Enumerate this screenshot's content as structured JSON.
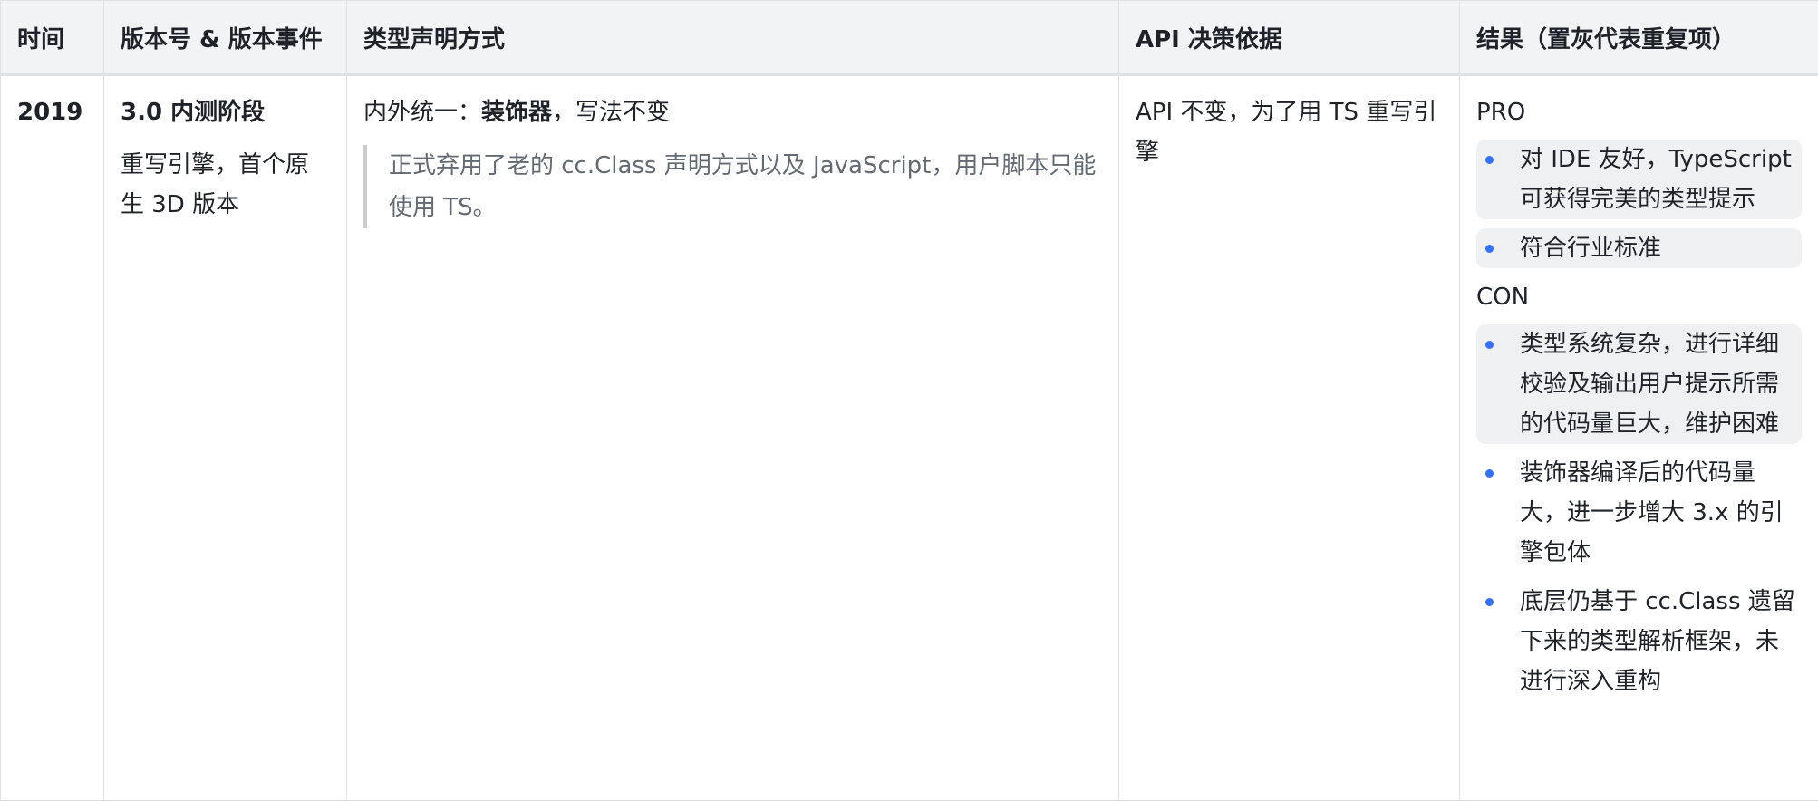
{
  "headers": {
    "time": "时间",
    "version": "版本号 & 版本事件",
    "type": "类型声明方式",
    "api": "API 决策依据",
    "result": "结果（置灰代表重复项）"
  },
  "row": {
    "time": "2019",
    "version_title": "3.0 内测阶段",
    "version_desc": "重写引擎，首个原生 3D 版本",
    "type_prefix": "内外统一：",
    "type_bold": "装饰器",
    "type_suffix": "，写法不变",
    "type_quote": "正式弃用了老的 cc.Class 声明方式以及 JavaScript，用户脚本只能使用 TS。",
    "api_basis": "API 不变，为了用 TS 重写引擎",
    "result": {
      "pro_label": "PRO",
      "pro_items": [
        {
          "text": "对 IDE 友好，TypeScript 可获得完美的类型提示",
          "greyed": true
        },
        {
          "text": "符合行业标准",
          "greyed": true
        }
      ],
      "con_label": "CON",
      "con_items": [
        {
          "text": "类型系统复杂，进行详细校验及输出用户提示所需的代码量巨大，维护困难",
          "greyed": true
        },
        {
          "text": "装饰器编译后的代码量大，进一步增大 3.x 的引擎包体",
          "greyed": false
        },
        {
          "text": "底层仍基于 cc.Class 遗留下来的类型解析框架，未进行深入重构",
          "greyed": false
        }
      ]
    }
  },
  "colors": {
    "header_bg": "#f2f3f5",
    "border": "#dee0e3",
    "grey_item_bg": "#eff0f2",
    "bullet": "#3370ff",
    "quote_text": "#646a73"
  }
}
